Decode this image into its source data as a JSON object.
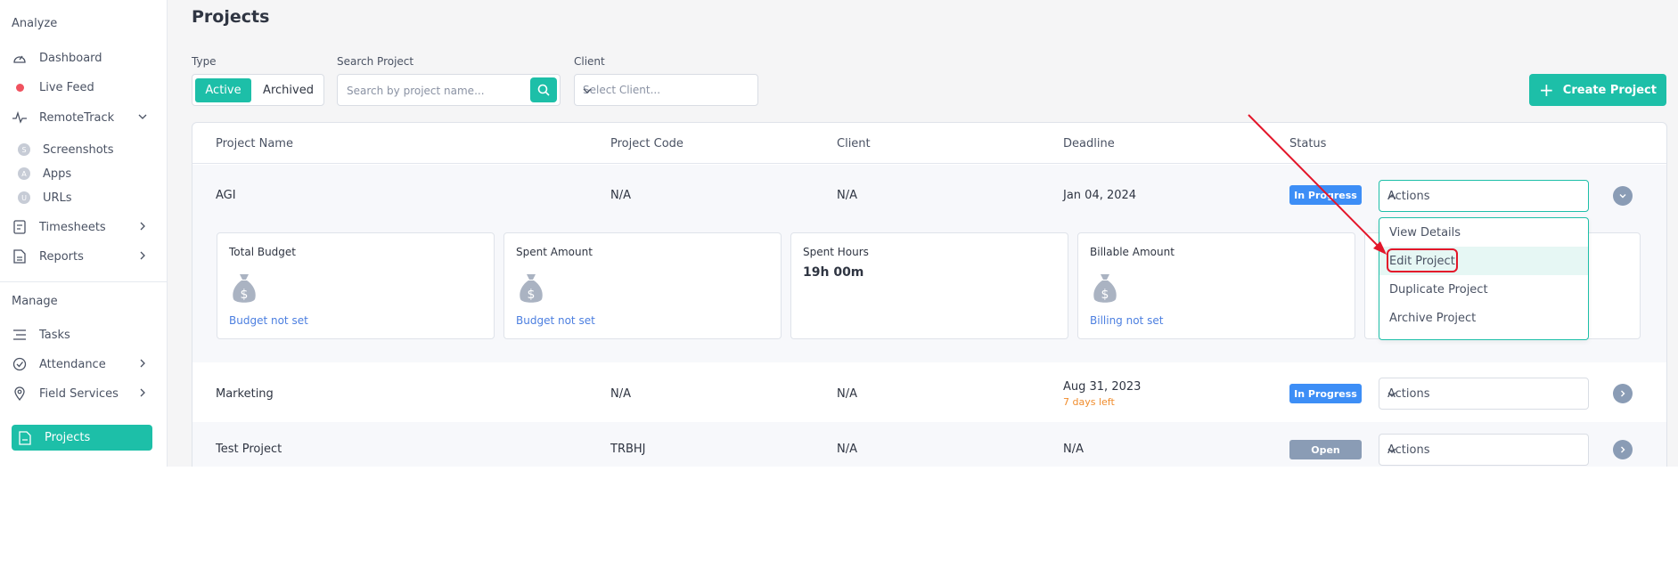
{
  "sidebar": {
    "analyze_label": "Analyze",
    "manage_label": "Manage",
    "items": {
      "dashboard": "Dashboard",
      "live_feed": "Live Feed",
      "remotetrack": "RemoteTrack",
      "screenshots": "Screenshots",
      "apps": "Apps",
      "urls": "URLs",
      "timesheets": "Timesheets",
      "reports": "Reports",
      "tasks": "Tasks",
      "attendance": "Attendance",
      "field_services": "Field Services",
      "projects": "Projects"
    },
    "sub_icon_letters": {
      "screenshots": "S",
      "apps": "A",
      "urls": "U"
    },
    "colors": {
      "active_bg": "#1dbfa8",
      "live_dot": "#f0525f"
    }
  },
  "page": {
    "title": "Projects"
  },
  "filters": {
    "type_label": "Type",
    "type_active": "Active",
    "type_archived": "Archived",
    "search_label": "Search Project",
    "search_placeholder": "Search by project name...",
    "client_label": "Client",
    "client_placeholder": "Select Client..."
  },
  "create_button": {
    "label": "Create Project"
  },
  "table": {
    "headers": {
      "name": "Project Name",
      "code": "Project Code",
      "client": "Client",
      "deadline": "Deadline",
      "status": "Status"
    },
    "rows": [
      {
        "name": "AGI",
        "code": "N/A",
        "client": "N/A",
        "deadline": "Jan 04, 2024",
        "deadline_note": "",
        "status": "In Progress",
        "actions": "Actions",
        "expanded": true
      },
      {
        "name": "Marketing",
        "code": "N/A",
        "client": "N/A",
        "deadline": "Aug 31, 2023",
        "deadline_note": "7 days left",
        "status": "In Progress",
        "actions": "Actions",
        "expanded": false
      },
      {
        "name": "Test Project",
        "code": "TRBHJ",
        "client": "N/A",
        "deadline": "N/A",
        "deadline_note": "",
        "status": "Open",
        "actions": "Actions",
        "expanded": false
      }
    ],
    "status_colors": {
      "in_progress": "#3d8ef6",
      "open": "#8a9cb5"
    }
  },
  "detail_cards": [
    {
      "title": "Total Budget",
      "link": "Budget not set",
      "icon": "money-bag-icon"
    },
    {
      "title": "Spent Amount",
      "link": "Budget not set",
      "icon": "money-bag-icon"
    },
    {
      "title": "Spent Hours",
      "value": "19h 00m"
    },
    {
      "title": "Billable Amount",
      "link": "Billing not set",
      "icon": "money-bag-icon"
    }
  ],
  "actions_menu": {
    "items": [
      "View Details",
      "Edit Project",
      "Duplicate Project",
      "Archive Project"
    ],
    "highlighted": "Edit Project"
  },
  "annotation": {
    "color": "#e3162a"
  }
}
